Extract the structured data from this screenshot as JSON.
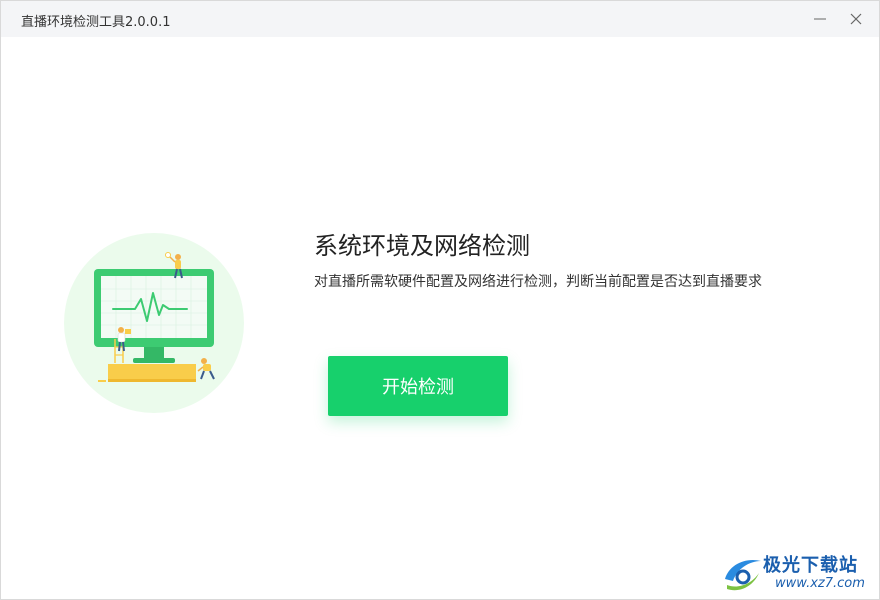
{
  "window": {
    "title": "直播环境检测工具2.0.0.1",
    "minimize_icon": "minimize-icon",
    "close_icon": "close-icon"
  },
  "main": {
    "heading": "系统环境及网络检测",
    "description": "对直播所需软硬件配置及网络进行检测，判断当前配置是否达到直播要求",
    "start_button_label": "开始检测",
    "illustration_icon": "monitor-illustration"
  },
  "colors": {
    "accent": "#17d06c",
    "illustration_bg": "#ebfbec",
    "monitor": "#3dcb72",
    "desk": "#f9cd4a"
  },
  "watermark": {
    "name": "极光下载站",
    "url": "www.xz7.com"
  }
}
